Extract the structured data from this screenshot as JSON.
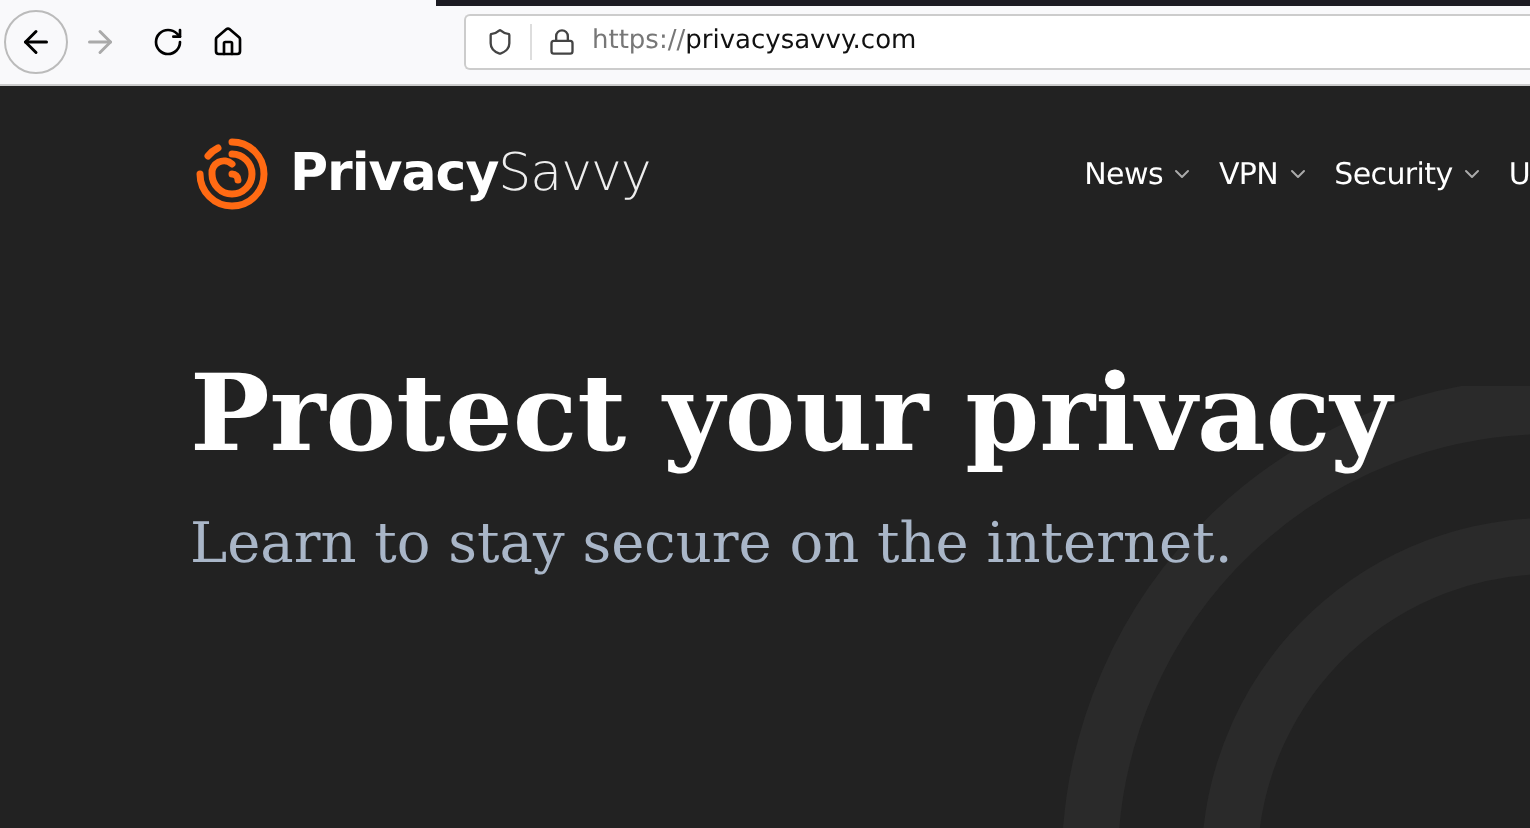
{
  "browser": {
    "url_scheme": "https://",
    "url_host": "privacysavvy.com"
  },
  "site": {
    "logo_bold": "Privacy",
    "logo_light": "Savvy",
    "nav": [
      {
        "label": "News",
        "has_menu": true
      },
      {
        "label": "VPN",
        "has_menu": true
      },
      {
        "label": "Security",
        "has_menu": true
      },
      {
        "label": "U",
        "has_menu": false
      }
    ]
  },
  "hero": {
    "title": "Protect your privacy",
    "subtitle": "Learn to stay secure on the internet."
  }
}
